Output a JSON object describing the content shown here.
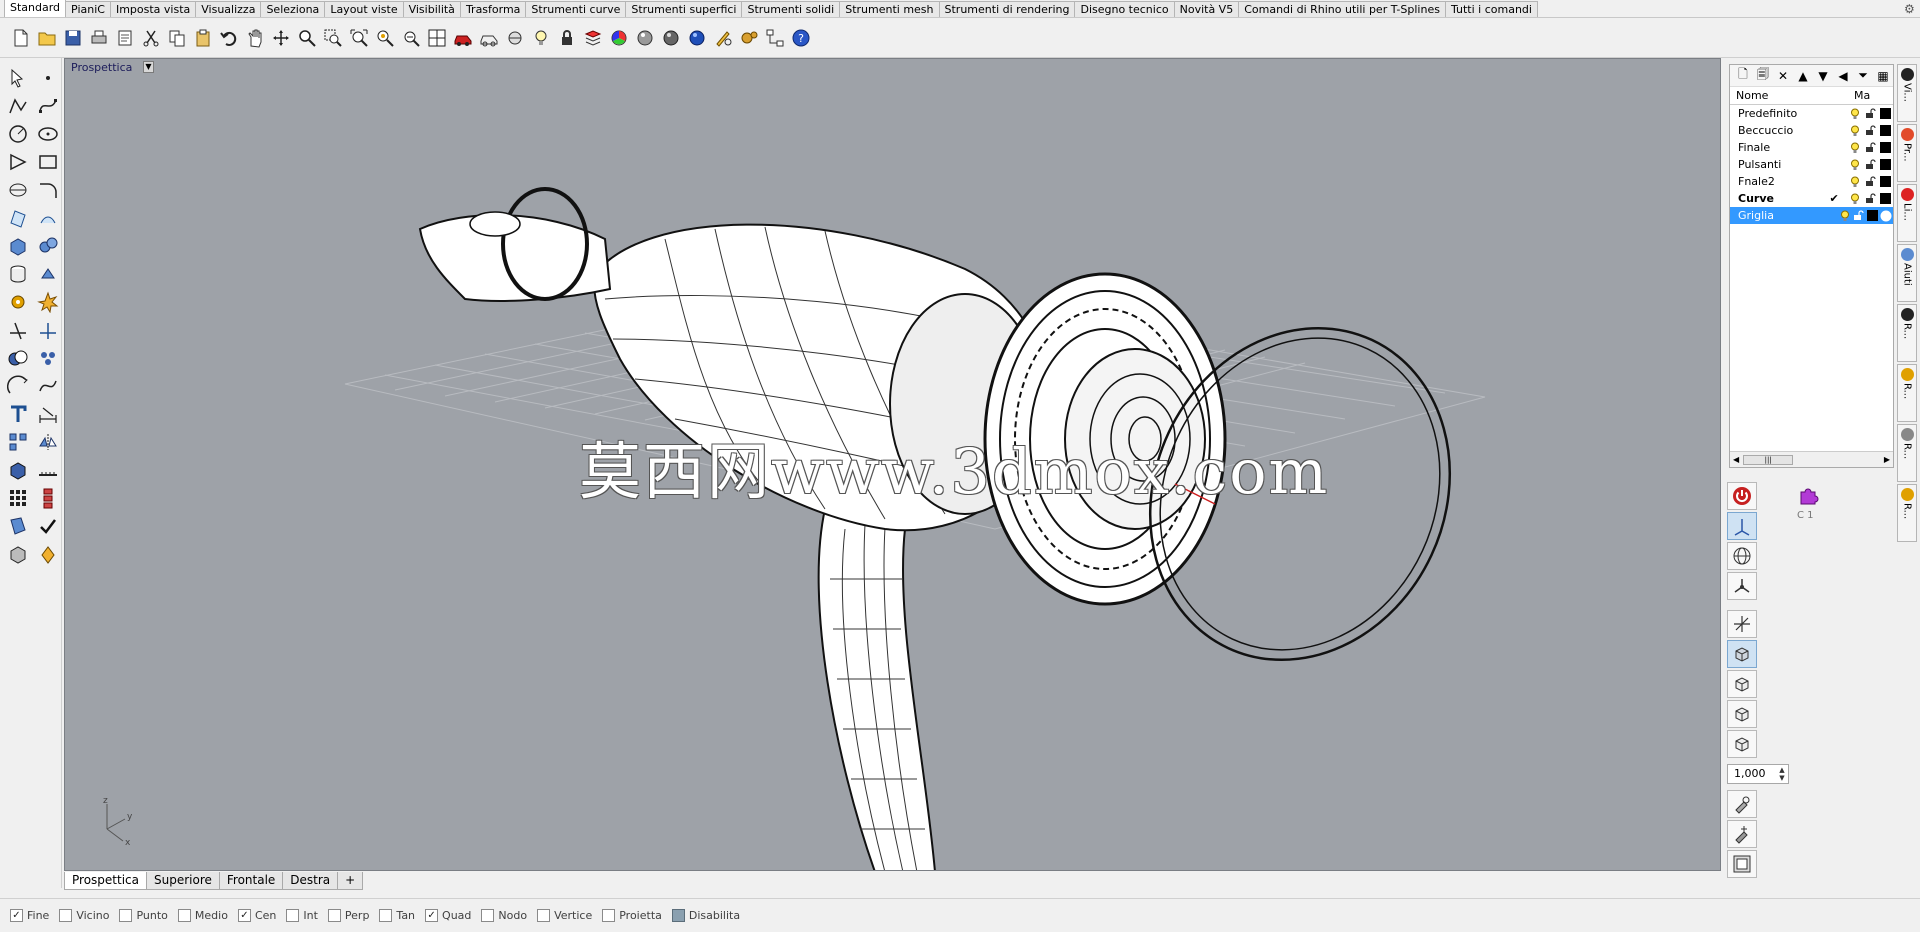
{
  "window": {
    "tabs": [
      "Standard",
      "PianiC",
      "Imposta vista",
      "Visualizza",
      "Seleziona",
      "Layout viste",
      "Visibilità",
      "Trasforma",
      "Strumenti curve",
      "Strumenti superfici",
      "Strumenti solidi",
      "Strumenti mesh",
      "Strumenti di rendering",
      "Disegno tecnico",
      "Novità V5",
      "Comandi di Rhino utili per T-Splines",
      "Tutti i comandi"
    ],
    "active_tab": "Standard"
  },
  "viewport": {
    "title": "Prospettica",
    "watermark": "莫西网www.3dmox.com",
    "axes": {
      "z": "z",
      "y": "y",
      "x": "x"
    }
  },
  "viewport_tabs": [
    "Prospettica",
    "Superiore",
    "Frontale",
    "Destra",
    "+"
  ],
  "snaps": [
    {
      "label": "Fine",
      "checked": true
    },
    {
      "label": "Vicino",
      "checked": false
    },
    {
      "label": "Punto",
      "checked": false
    },
    {
      "label": "Medio",
      "checked": false
    },
    {
      "label": "Cen",
      "checked": true
    },
    {
      "label": "Int",
      "checked": false
    },
    {
      "label": "Perp",
      "checked": false
    },
    {
      "label": "Tan",
      "checked": false
    },
    {
      "label": "Quad",
      "checked": true
    },
    {
      "label": "Nodo",
      "checked": false
    },
    {
      "label": "Vertice",
      "checked": false
    },
    {
      "label": "Proietta",
      "checked": false
    },
    {
      "label": "Disabilita",
      "checked": false,
      "button": true
    }
  ],
  "layers": {
    "header_name": "Nome",
    "header_material": "Ma",
    "rows": [
      {
        "name": "Predefinito",
        "current": false,
        "selected": false,
        "check": ""
      },
      {
        "name": "Beccuccio",
        "current": false,
        "selected": false,
        "check": ""
      },
      {
        "name": "Finale",
        "current": false,
        "selected": false,
        "check": ""
      },
      {
        "name": "Pulsanti",
        "current": false,
        "selected": false,
        "check": ""
      },
      {
        "name": "Fnale2",
        "current": false,
        "selected": false,
        "check": ""
      },
      {
        "name": "Curve",
        "current": true,
        "selected": false,
        "check": "✔"
      },
      {
        "name": "Griglia",
        "current": false,
        "selected": true,
        "check": ""
      }
    ]
  },
  "side_tabs": [
    "Vi...",
    "Pr...",
    "Li...",
    "Aiuti",
    "R...",
    "R...",
    "R...",
    "R..."
  ],
  "gumball": {
    "value": "1,000",
    "c1_label": "C 1"
  }
}
